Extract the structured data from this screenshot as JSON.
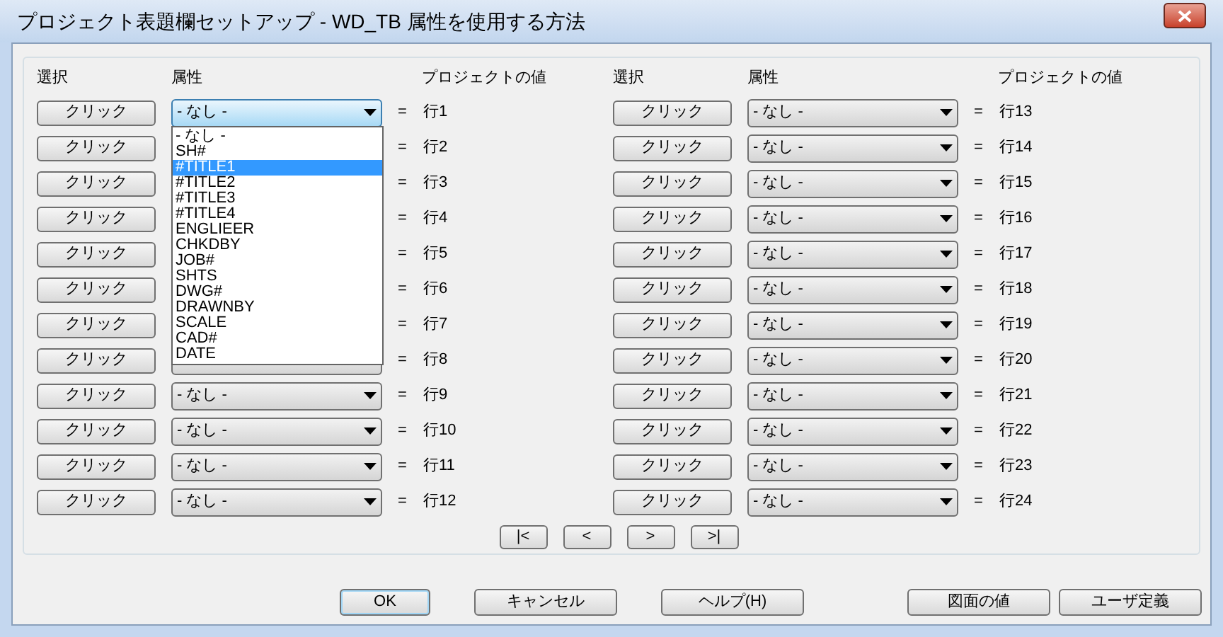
{
  "window": {
    "title": "プロジェクト表題欄セットアップ - WD_TB 属性を使用する方法"
  },
  "columns": [
    {
      "select": "選択",
      "attribute": "属性",
      "value": "プロジェクトの値"
    },
    {
      "select": "選択",
      "attribute": "属性",
      "value": "プロジェクトの値"
    }
  ],
  "left_rows": [
    {
      "button": "クリック",
      "attribute": "- なし -",
      "equals": "=",
      "value": "行1",
      "expanded": true,
      "options": [
        {
          "label": "- なし -",
          "selected": false
        },
        {
          "label": "SH#",
          "selected": false
        },
        {
          "label": "#TITLE1",
          "selected": true
        },
        {
          "label": "#TITLE2",
          "selected": false
        },
        {
          "label": "#TITLE3",
          "selected": false
        },
        {
          "label": "#TITLE4",
          "selected": false
        },
        {
          "label": "ENGLIEER",
          "selected": false
        },
        {
          "label": "CHKDBY",
          "selected": false
        },
        {
          "label": "JOB#",
          "selected": false
        },
        {
          "label": "SHTS",
          "selected": false
        },
        {
          "label": "DWG#",
          "selected": false
        },
        {
          "label": "DRAWNBY",
          "selected": false
        },
        {
          "label": "SCALE",
          "selected": false
        },
        {
          "label": "CAD#",
          "selected": false
        },
        {
          "label": "DATE",
          "selected": false
        }
      ]
    },
    {
      "button": "クリック",
      "equals": "=",
      "value": "行2"
    },
    {
      "button": "クリック",
      "equals": "=",
      "value": "行3"
    },
    {
      "button": "クリック",
      "equals": "=",
      "value": "行4"
    },
    {
      "button": "クリック",
      "equals": "=",
      "value": "行5"
    },
    {
      "button": "クリック",
      "equals": "=",
      "value": "行6"
    },
    {
      "button": "クリック",
      "equals": "=",
      "value": "行7"
    },
    {
      "button": "クリック",
      "equals": "=",
      "value": "行8"
    },
    {
      "button": "クリック",
      "attribute": "- なし -",
      "equals": "=",
      "value": "行9"
    },
    {
      "button": "クリック",
      "attribute": "- なし -",
      "equals": "=",
      "value": "行10"
    },
    {
      "button": "クリック",
      "attribute": "- なし -",
      "equals": "=",
      "value": "行11"
    },
    {
      "button": "クリック",
      "attribute": "- なし -",
      "equals": "=",
      "value": "行12"
    }
  ],
  "right_rows": [
    {
      "button": "クリック",
      "attribute": "- なし -",
      "equals": "=",
      "value": "行13"
    },
    {
      "button": "クリック",
      "attribute": "- なし -",
      "equals": "=",
      "value": "行14"
    },
    {
      "button": "クリック",
      "attribute": "- なし -",
      "equals": "=",
      "value": "行15"
    },
    {
      "button": "クリック",
      "attribute": "- なし -",
      "equals": "=",
      "value": "行16"
    },
    {
      "button": "クリック",
      "attribute": "- なし -",
      "equals": "=",
      "value": "行17"
    },
    {
      "button": "クリック",
      "attribute": "- なし -",
      "equals": "=",
      "value": "行18"
    },
    {
      "button": "クリック",
      "attribute": "- なし -",
      "equals": "=",
      "value": "行19"
    },
    {
      "button": "クリック",
      "attribute": "- なし -",
      "equals": "=",
      "value": "行20"
    },
    {
      "button": "クリック",
      "attribute": "- なし -",
      "equals": "=",
      "value": "行21"
    },
    {
      "button": "クリック",
      "attribute": "- なし -",
      "equals": "=",
      "value": "行22"
    },
    {
      "button": "クリック",
      "attribute": "- なし -",
      "equals": "=",
      "value": "行23"
    },
    {
      "button": "クリック",
      "attribute": "- なし -",
      "equals": "=",
      "value": "行24"
    }
  ],
  "pager": [
    "|<",
    "<",
    ">",
    ">|"
  ],
  "buttons": [
    {
      "label": "OK",
      "kind": "default"
    },
    {
      "label": "キャンセル",
      "kind": "normal"
    },
    {
      "label": "ヘルプ(H)",
      "kind": "normal"
    }
  ],
  "right_buttons": [
    {
      "label": "図面の値"
    },
    {
      "label": "ユーザ定義"
    }
  ]
}
